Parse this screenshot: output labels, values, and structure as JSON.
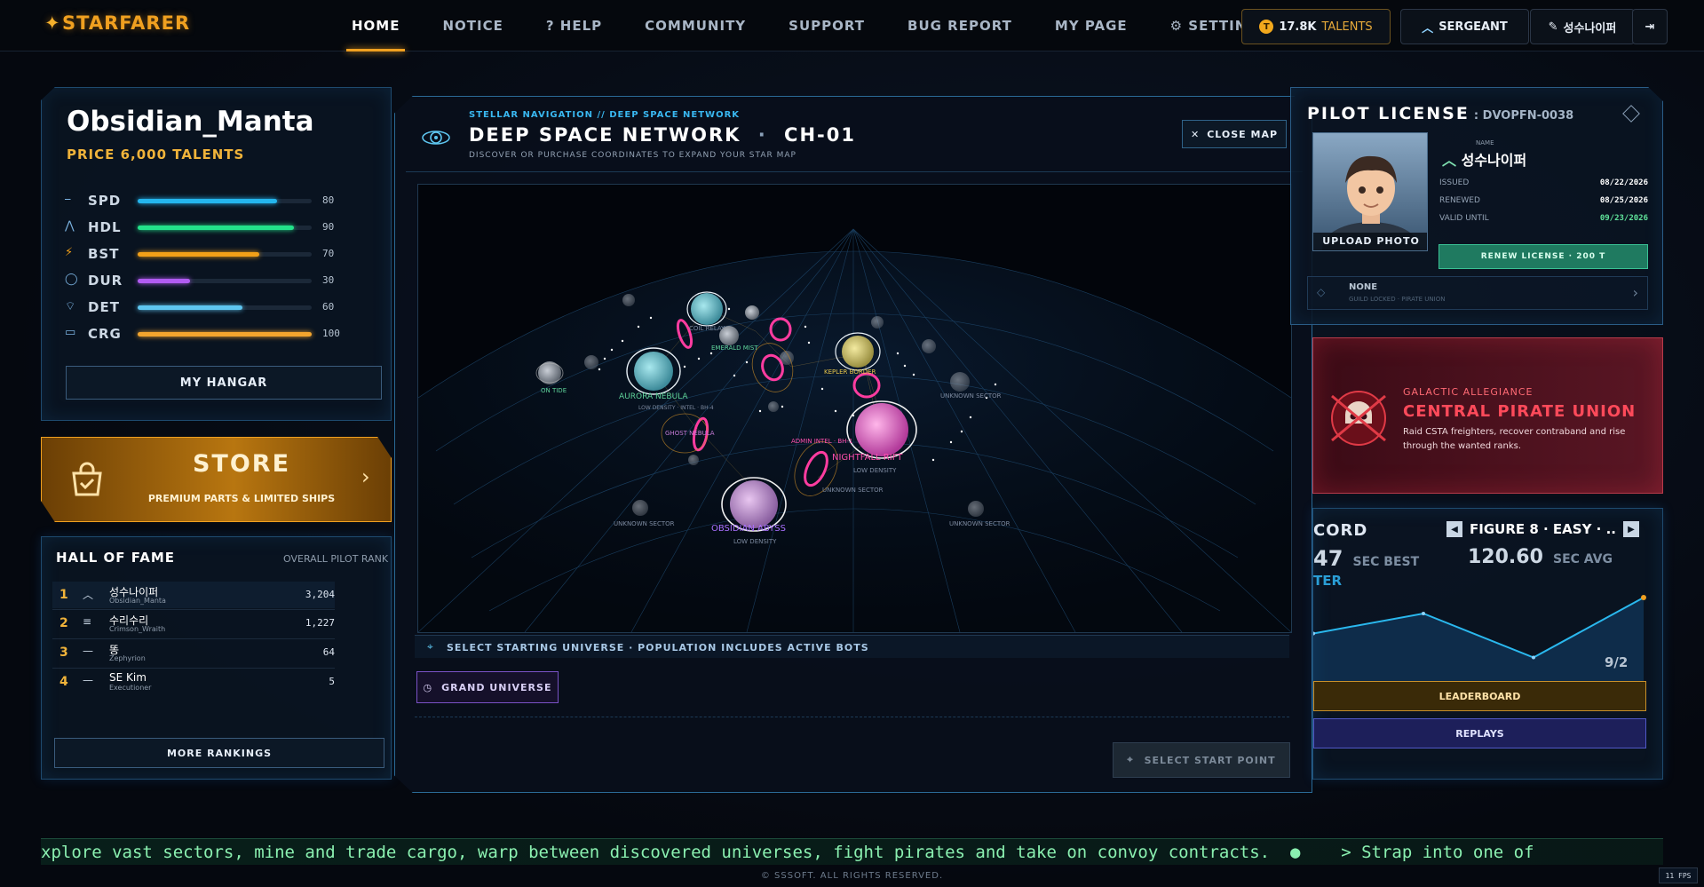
{
  "header": {
    "logo": "STARFARER",
    "nav": [
      "HOME",
      "NOTICE",
      "? HELP",
      "COMMUNITY",
      "SUPPORT",
      "BUG REPORT",
      "MY PAGE",
      "⚙ SETTINGS"
    ],
    "talents": "17.8K",
    "talents_label": "TALENTS",
    "rank": "SERGEANT",
    "user": "성수나이퍼"
  },
  "ship": {
    "name": "Obsidian_Manta",
    "price": "PRICE 6,000 TALENTS",
    "stats": [
      {
        "label": "SPD",
        "value": 80,
        "color": "#24b6ee"
      },
      {
        "label": "HDL",
        "value": 90,
        "color": "#23e28a"
      },
      {
        "label": "BST",
        "value": 70,
        "color": "#f2a018"
      },
      {
        "label": "DUR",
        "value": 30,
        "color": "#b25cf2"
      },
      {
        "label": "DET",
        "value": 60,
        "color": "#5ec6f0"
      },
      {
        "label": "CRG",
        "value": 100,
        "color": "#f3a52e"
      }
    ],
    "stat_max": 100,
    "hangar_button": "MY HANGAR"
  },
  "store": {
    "title": "STORE",
    "subtitle": "PREMIUM PARTS & LIMITED SHIPS"
  },
  "hall_of_fame": {
    "title": "HALL OF FAME",
    "subtitle": "OVERALL PILOT RANK",
    "rows": [
      {
        "rank": "1",
        "name": "성수나이퍼",
        "tag": "Obsidian_Manta",
        "score": "3,204"
      },
      {
        "rank": "2",
        "name": "수리수리",
        "tag": "Crimson_Wraith",
        "score": "1,227"
      },
      {
        "rank": "3",
        "name": "똥",
        "tag": "Zephyrion",
        "score": "64"
      },
      {
        "rank": "4",
        "name": "SE Kim",
        "tag": "Executioner",
        "score": "5"
      }
    ],
    "more_button": "MORE RANKINGS"
  },
  "map": {
    "kicker": "STELLAR NAVIGATION // DEEP SPACE NETWORK",
    "title": "DEEP SPACE NETWORK",
    "channel": "CH-01",
    "subtitle": "DISCOVER OR PURCHASE COORDINATES TO EXPAND YOUR STAR MAP",
    "close_button": "CLOSE MAP",
    "status_bar": "SELECT STARTING UNIVERSE · POPULATION INCLUDES ACTIVE BOTS",
    "grand_button": "GRAND UNIVERSE",
    "select_button": "SELECT START POINT",
    "labels": {
      "aurora": "AURORA NEBULA",
      "aurora_sub": "LOW DENSITY · INTEL · BH-4",
      "nightfall": "NIGHTFALL RIFT",
      "nightfall_sub": "LOW DENSITY",
      "obsidian": "OBSIDIAN ABYSS",
      "obsidian_sub": "LOW DENSITY",
      "emerald": "EMERALD MIST",
      "kepler": "KEPLER BORDER",
      "ghost": "GHOST NEBULA",
      "unknown": "UNKNOWN SECTOR",
      "coil": "COIL RELAY",
      "ontide": "ON TIDE",
      "admin": "ADMIN INTEL · BH-1"
    }
  },
  "license": {
    "title": "PILOT LICENSE",
    "code": ": DVOPFN-0038",
    "name_label": "NAME",
    "name": "성수나이퍼",
    "issued_label": "ISSUED",
    "issued": "08/22/2026",
    "renewed_label": "RENEWED",
    "renewed": "08/25/2026",
    "valid_label": "VALID UNTIL",
    "valid": "09/23/2026",
    "upload": "UPLOAD PHOTO",
    "renew_button": "RENEW LICENSE · 200 T",
    "guild": "NONE",
    "guild_sub": "GUILD LOCKED · PIRATE UNION"
  },
  "allegiance": {
    "kicker": "GALACTIC ALLEGIANCE",
    "title": "CENTRAL PIRATE UNION",
    "desc1": "Raid CSTA freighters, recover contraband and rise",
    "desc2": "through the wanted ranks."
  },
  "record": {
    "title": "CORD",
    "course": "FIGURE 8 · EASY · ..",
    "best": "47",
    "best_label": "SEC BEST",
    "avg": "120.60",
    "avg_label": "SEC AVG",
    "sub": "TER",
    "date": "9/2",
    "leaderboard": "LEADERBOARD",
    "replays": "REPLAYS",
    "chart_data": {
      "type": "line",
      "x": [
        1,
        2,
        3,
        4
      ],
      "y": [
        0.55,
        0.8,
        0.25,
        1.0
      ],
      "title": "",
      "xlabel": "",
      "ylabel": ""
    }
  },
  "ticker": "xplore vast sectors, mine and trade cargo, warp between discovered universes, fight pirates and take on convoy contracts.  ●    > Strap into one of",
  "footer": "© SSSOFT. ALL RIGHTS RESERVED.",
  "fps": "11 FPS",
  "colors": {
    "accent": "#f0a020",
    "cyan": "#2ab8ee",
    "pink": "#ff3ca0",
    "pirate": "#ff4a5a"
  }
}
